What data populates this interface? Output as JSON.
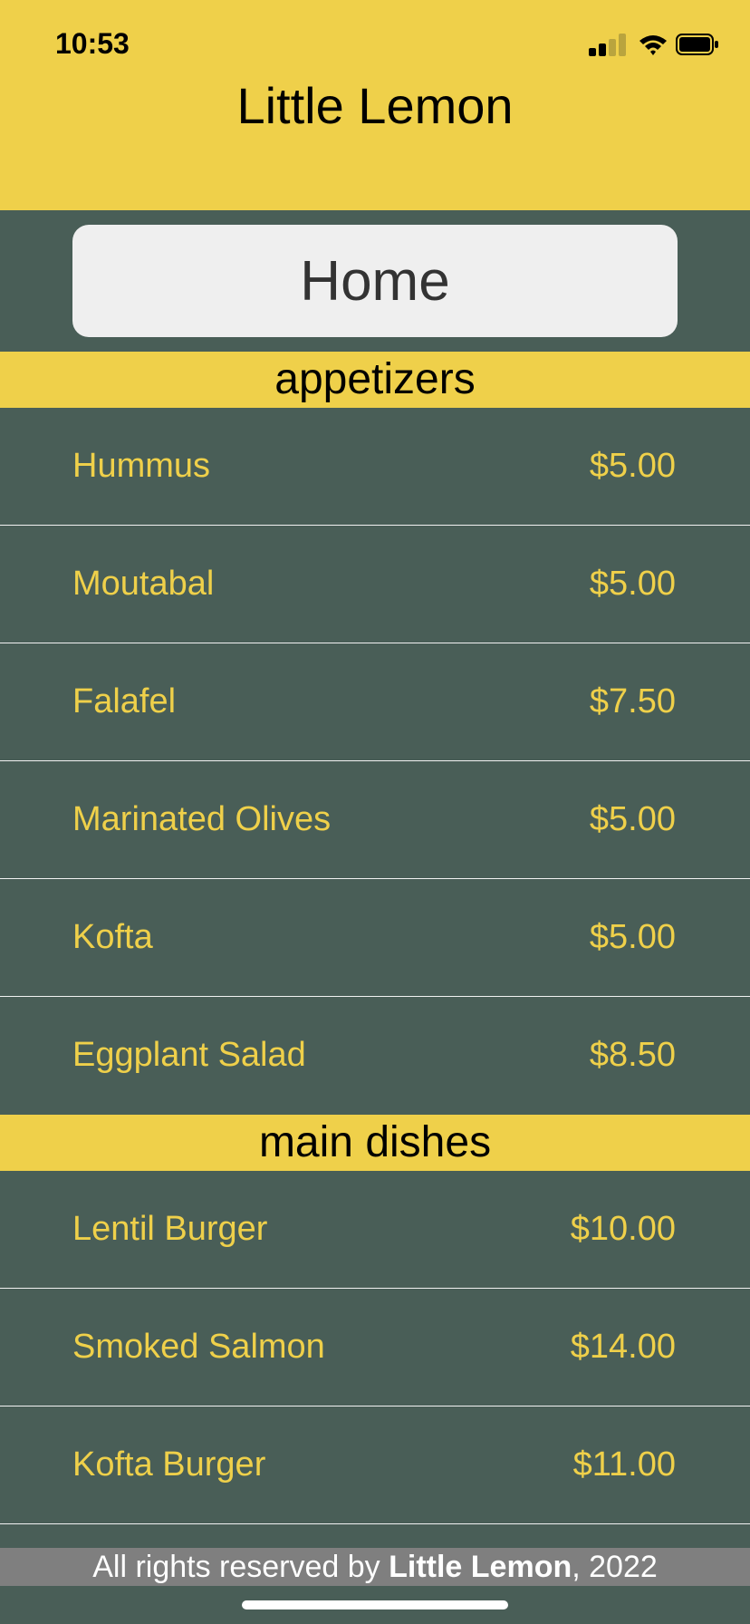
{
  "status_bar": {
    "time": "10:53",
    "signal_icon": "cellular-signal-icon",
    "wifi_icon": "wifi-icon",
    "battery_icon": "battery-icon"
  },
  "header": {
    "title": "Little Lemon"
  },
  "home_button": {
    "label": "Home"
  },
  "sections": [
    {
      "title": "appetizers",
      "items": [
        {
          "name": "Hummus",
          "price": "$5.00"
        },
        {
          "name": "Moutabal",
          "price": "$5.00"
        },
        {
          "name": "Falafel",
          "price": "$7.50"
        },
        {
          "name": "Marinated Olives",
          "price": "$5.00"
        },
        {
          "name": "Kofta",
          "price": "$5.00"
        },
        {
          "name": "Eggplant Salad",
          "price": "$8.50"
        }
      ]
    },
    {
      "title": "main dishes",
      "items": [
        {
          "name": "Lentil Burger",
          "price": "$10.00"
        },
        {
          "name": "Smoked Salmon",
          "price": "$14.00"
        },
        {
          "name": "Kofta Burger",
          "price": "$11.00"
        }
      ]
    }
  ],
  "footer": {
    "prefix": "All rights reserved by ",
    "brand": "Little Lemon",
    "suffix": ", 2022"
  },
  "colors": {
    "primary_yellow": "#EFD04A",
    "primary_green": "#495E57",
    "footer_gray": "#7F7F7F",
    "button_bg": "#EFEFEF"
  }
}
